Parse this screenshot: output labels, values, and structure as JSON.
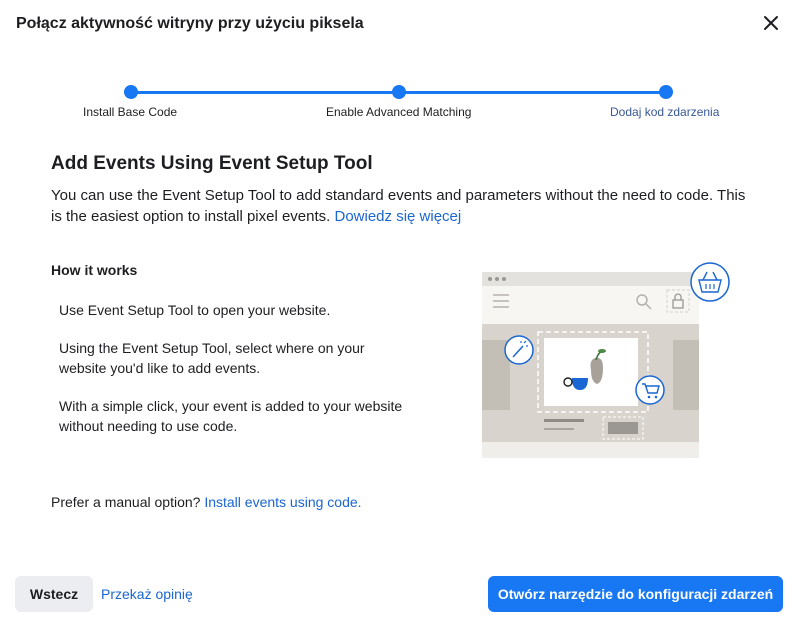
{
  "dialog": {
    "title": "Połącz aktywność witryny przy użyciu piksela",
    "close_icon": "close-icon"
  },
  "stepper": {
    "steps": [
      {
        "label": "Install Base Code",
        "state": "completed"
      },
      {
        "label": "Enable Advanced Matching",
        "state": "completed"
      },
      {
        "label": "Dodaj kod zdarzenia",
        "state": "current"
      }
    ],
    "accent_color": "#1877f2"
  },
  "content": {
    "heading": "Add Events Using Event Setup Tool",
    "description": "You can use the Event Setup Tool to add standard events and parameters without the need to code. This is the easiest option to install pixel events.",
    "learn_more_link": "Dowiedz się więcej",
    "how_it_works_title": "How it works",
    "steps": [
      "Use Event Setup Tool to open your website.",
      "Using the Event Setup Tool, select where on your website you'd like to add events.",
      "With a simple click, your event is added to your website without needing to use code."
    ],
    "manual_prompt": "Prefer a manual option?",
    "manual_link": "Install events using code."
  },
  "footer": {
    "back_label": "Wstecz",
    "feedback_link": "Przekaż opinię",
    "primary_label": "Otwórz narzędzie do konfiguracji zdarzeń"
  },
  "illustration": {
    "icons": [
      "basket-icon",
      "magic-wand-icon",
      "cart-icon",
      "lock-icon",
      "search-icon",
      "hamburger-menu-icon"
    ]
  }
}
